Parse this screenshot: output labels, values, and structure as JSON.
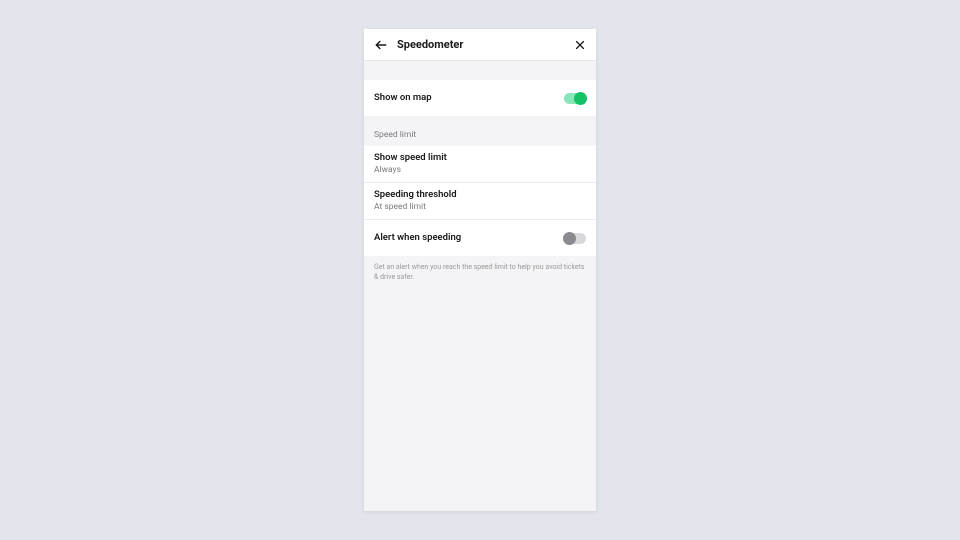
{
  "header": {
    "title": "Speedometer"
  },
  "row_show_on_map": {
    "label": "Show on map",
    "toggle_on": true
  },
  "section_speed_limit": {
    "header": "Speed limit"
  },
  "row_show_speed_limit": {
    "label": "Show speed limit",
    "value": "Always"
  },
  "row_threshold": {
    "label": "Speeding threshold",
    "value": "At speed limit"
  },
  "row_alert": {
    "label": "Alert when speeding",
    "toggle_on": false
  },
  "helper": {
    "text": "Get an alert when you reach the speed limit to help you avoid tickets & drive safer."
  }
}
